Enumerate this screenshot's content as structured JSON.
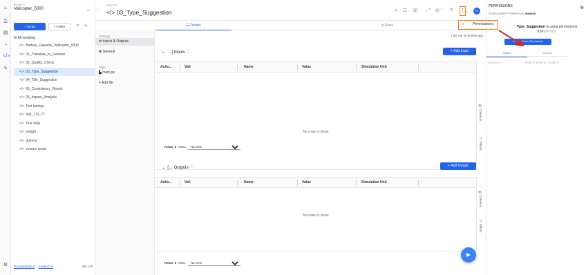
{
  "rail": {
    "icons": [
      "home-icon",
      "layers-icon",
      "document-icon",
      "analytics-icon",
      "code-icon",
      "pin-icon"
    ],
    "settings_icon": "gear-icon"
  },
  "models": {
    "caption": "MODELS",
    "name": "Valicopter_5000"
  },
  "sidebar": {
    "script_button": "+ Script",
    "folder_button": "+ Folder",
    "root_label": "All scripting",
    "items": [
      {
        "tag": "</>",
        "label": "Battery_Capacity_Valicopter_5000"
      },
      {
        "tag": "</>",
        "label": "01_Translate_to_German"
      },
      {
        "tag": "</>",
        "label": "02_Quality_Check"
      },
      {
        "tag": "</>",
        "label": "03_Type_Suggestion",
        "selected": true
      },
      {
        "tag": "</>",
        "label": "04_Title_Suggestion"
      },
      {
        "tag": "</>",
        "label": "05_Consistency_Report"
      },
      {
        "tag": "</>",
        "label": "06_Impact_Analysis"
      },
      {
        "tag": "</>",
        "label": "Test kwargs"
      },
      {
        "tag": "</>",
        "label": "test_173_77"
      },
      {
        "tag": "</>",
        "label": "Test Vells"
      },
      {
        "tag": "</>",
        "label": "testgpt"
      },
      {
        "tag": "</>",
        "label": "dummy"
      },
      {
        "tag": "</>",
        "label": "version script"
      }
    ],
    "footer": {
      "documentation": "Documentation",
      "contact": "Contact us",
      "version": "2.149"
    }
  },
  "header": {
    "caption": "SCRIPTS",
    "title": "</> 03_Type_Suggestion",
    "icons": [
      "search-icon",
      "list-icon",
      "chat-icon",
      "bell-icon",
      "check-icon",
      "help-icon"
    ],
    "badges": {
      "bell": "57",
      "check": "4"
    },
    "avatar": "PA"
  },
  "tabs": {
    "details": "Details",
    "runs": "Runs"
  },
  "settings": {
    "section_label": "Settings",
    "items": [
      {
        "label": "Inputs & Outputs",
        "selected": true
      },
      {
        "label": "General"
      }
    ],
    "files_label": "Files",
    "files": [
      {
        "label": "main.py"
      }
    ],
    "add_file": "+ Add file"
  },
  "main": {
    "last_run": "Last run: 9 months ago",
    "inputs": {
      "title": "Inputs",
      "add_button": "+ Add Input",
      "empty": "No rows to show"
    },
    "outputs": {
      "title": "Outputs",
      "add_button": "+ Add Output",
      "empty": "No rows to show"
    },
    "columns": [
      "Actio...",
      "Vali",
      "Name",
      "Value",
      "Simulation Unit"
    ],
    "side_labels": {
      "columns": "Columns",
      "filters": "Filters"
    },
    "pager": {
      "rows_label": "Rows: 0",
      "view_label": "View:",
      "view_value": "No view"
    }
  },
  "permissions_tab": "Permissions",
  "panel": {
    "title": "PERMISSIONS",
    "subtitle_prefix": "YOUR CURRENT PERMISSION:",
    "subtitle_value": "MANAGE",
    "message_bold": "Type_Suggestion",
    "message_rest": "is using permissions",
    "message_from": "from",
    "message_from_value": "Models",
    "create_button": "Create Custom Permissions",
    "tab_users": "Users",
    "tab_groups": "Groups",
    "everyone": "Everyone",
    "everyone_perm": "Read & Write & Create"
  },
  "colors": {
    "accent": "#2563eb",
    "highlight": "#f97316",
    "arrow": "#dc2626",
    "selection": "#dbeafe"
  }
}
